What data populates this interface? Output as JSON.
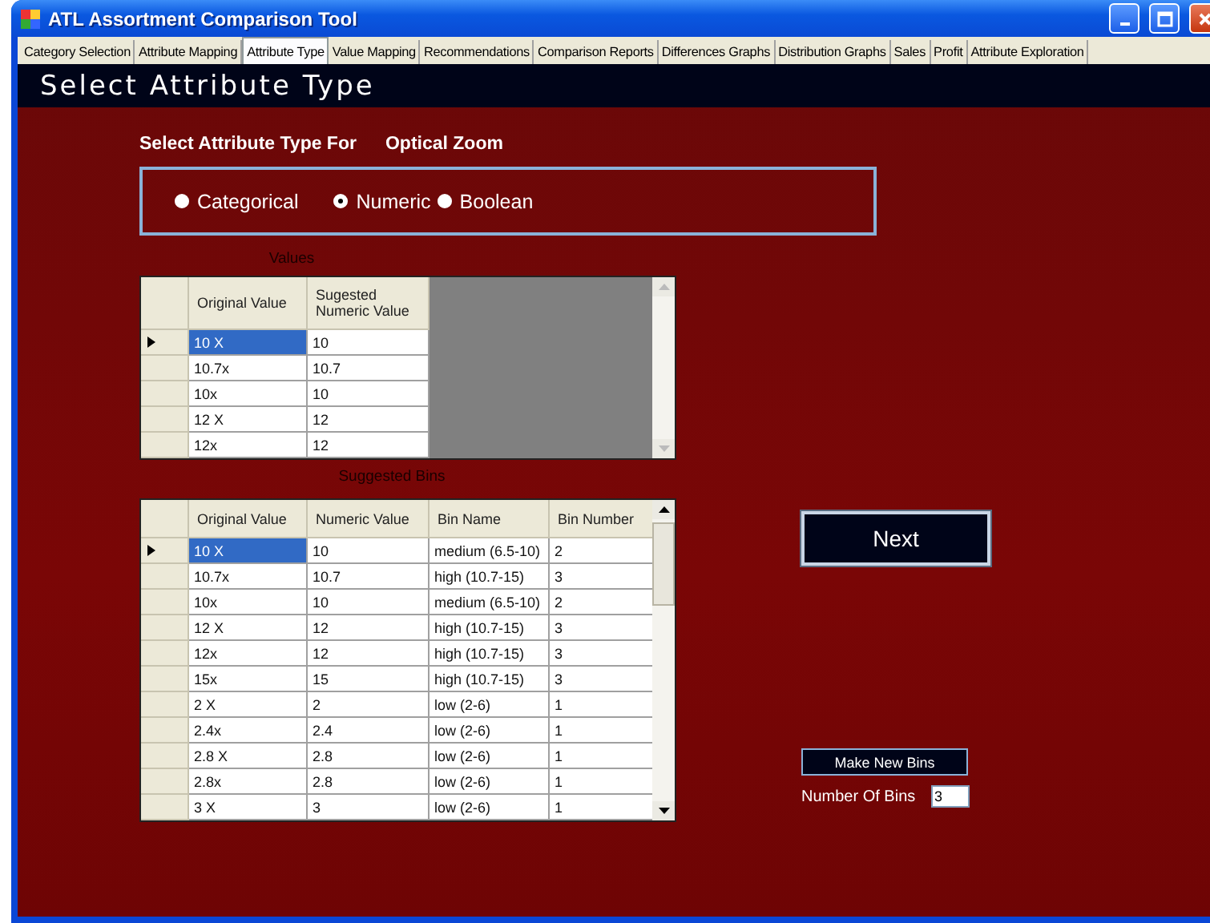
{
  "window": {
    "title": "ATL Assortment Comparison Tool"
  },
  "tabs": [
    {
      "label": "Category Selection",
      "selected": false
    },
    {
      "label": "Attribute Mapping",
      "selected": false
    },
    {
      "label": "Attribute Type",
      "selected": true
    },
    {
      "label": "Value Mapping",
      "selected": false
    },
    {
      "label": "Recommendations",
      "selected": false
    },
    {
      "label": "Comparison Reports",
      "selected": false
    },
    {
      "label": "Differences Graphs",
      "selected": false
    },
    {
      "label": "Distribution Graphs",
      "selected": false
    },
    {
      "label": "Sales",
      "selected": false
    },
    {
      "label": "Profit",
      "selected": false
    },
    {
      "label": "Attribute Exploration",
      "selected": false
    }
  ],
  "header": {
    "title": "Select Attribute Type"
  },
  "prompt": {
    "label": "Select Attribute Type For",
    "attribute": "Optical Zoom"
  },
  "attribute_types": [
    {
      "label": "Categorical",
      "selected": false
    },
    {
      "label": "Numeric",
      "selected": true
    },
    {
      "label": "Boolean",
      "selected": false
    }
  ],
  "values_table": {
    "caption": "Values",
    "columns": [
      "Original Value",
      "Sugested Numeric Value"
    ],
    "rows": [
      {
        "cells": [
          "10 X",
          "10"
        ],
        "selected": true
      },
      {
        "cells": [
          "10.7x",
          "10.7"
        ],
        "selected": false
      },
      {
        "cells": [
          "10x",
          "10"
        ],
        "selected": false
      },
      {
        "cells": [
          "12 X",
          "12"
        ],
        "selected": false
      },
      {
        "cells": [
          "12x",
          "12"
        ],
        "selected": false
      }
    ]
  },
  "bins_table": {
    "caption": "Suggested Bins",
    "columns": [
      "Original Value",
      "Numeric Value",
      "Bin Name",
      "Bin Number"
    ],
    "rows": [
      {
        "cells": [
          "10 X",
          "10",
          "medium (6.5-10)",
          "2"
        ],
        "selected": true
      },
      {
        "cells": [
          "10.7x",
          "10.7",
          "high (10.7-15)",
          "3"
        ],
        "selected": false
      },
      {
        "cells": [
          "10x",
          "10",
          "medium (6.5-10)",
          "2"
        ],
        "selected": false
      },
      {
        "cells": [
          "12 X",
          "12",
          "high (10.7-15)",
          "3"
        ],
        "selected": false
      },
      {
        "cells": [
          "12x",
          "12",
          "high (10.7-15)",
          "3"
        ],
        "selected": false
      },
      {
        "cells": [
          "15x",
          "15",
          "high (10.7-15)",
          "3"
        ],
        "selected": false
      },
      {
        "cells": [
          "2 X",
          "2",
          "low (2-6)",
          "1"
        ],
        "selected": false
      },
      {
        "cells": [
          "2.4x",
          "2.4",
          "low (2-6)",
          "1"
        ],
        "selected": false
      },
      {
        "cells": [
          "2.8 X",
          "2.8",
          "low (2-6)",
          "1"
        ],
        "selected": false
      },
      {
        "cells": [
          "2.8x",
          "2.8",
          "low (2-6)",
          "1"
        ],
        "selected": false
      },
      {
        "cells": [
          "3 X",
          "3",
          "low (2-6)",
          "1"
        ],
        "selected": false
      }
    ]
  },
  "next_button": {
    "label": "Next"
  },
  "make_bins_button": {
    "label": "Make New Bins"
  },
  "number_of_bins": {
    "label": "Number Of Bins",
    "value": "3"
  }
}
